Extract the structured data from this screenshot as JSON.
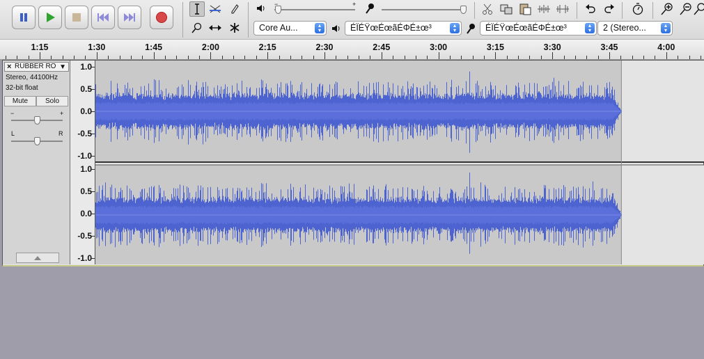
{
  "toolbar": {
    "transport": [
      {
        "name": "pause-button",
        "icon": "pause-icon"
      },
      {
        "name": "play-button",
        "icon": "play-icon"
      },
      {
        "name": "stop-button",
        "icon": "stop-icon"
      },
      {
        "name": "skip-to-start-button",
        "icon": "skip-start-icon"
      },
      {
        "name": "skip-to-end-button",
        "icon": "skip-end-icon"
      },
      {
        "name": "record-button",
        "icon": "record-icon"
      }
    ],
    "playback_volume_level": 0.03,
    "record_volume_level": 1.0,
    "host_device": "Core Au...",
    "playback_device": "ÉÏÉŸœÉœãÉΦÉ±œ³",
    "recording_device": "ÉÏÉŸœÉœãÉΦÉ±œ³",
    "channels": "2 (Stereo...",
    "colors": {
      "accent_play": "#2fa52f",
      "record": "#cc2020",
      "pause": "#3a5fc9",
      "waveform": "#4d63cf"
    }
  },
  "ruler": {
    "labels": [
      "1:15",
      "1:30",
      "1:45",
      "2:00",
      "2:15",
      "2:30",
      "2:45",
      "3:00",
      "3:15",
      "3:30",
      "3:45",
      "4:00"
    ]
  },
  "track": {
    "name": "RUBBER RO",
    "format_line1": "Stereo, 44100Hz",
    "format_line2": "32-bit float",
    "mute_label": "Mute",
    "solo_label": "Solo",
    "gain_minus": "−",
    "gain_plus": "+",
    "pan_left": "L",
    "pan_right": "R",
    "gain_level": 0.5,
    "pan_level": 0.5,
    "scale_labels": [
      "1.0",
      "0.5",
      "0.0",
      "-0.5",
      "-1.0"
    ],
    "end_time": "3:48"
  }
}
